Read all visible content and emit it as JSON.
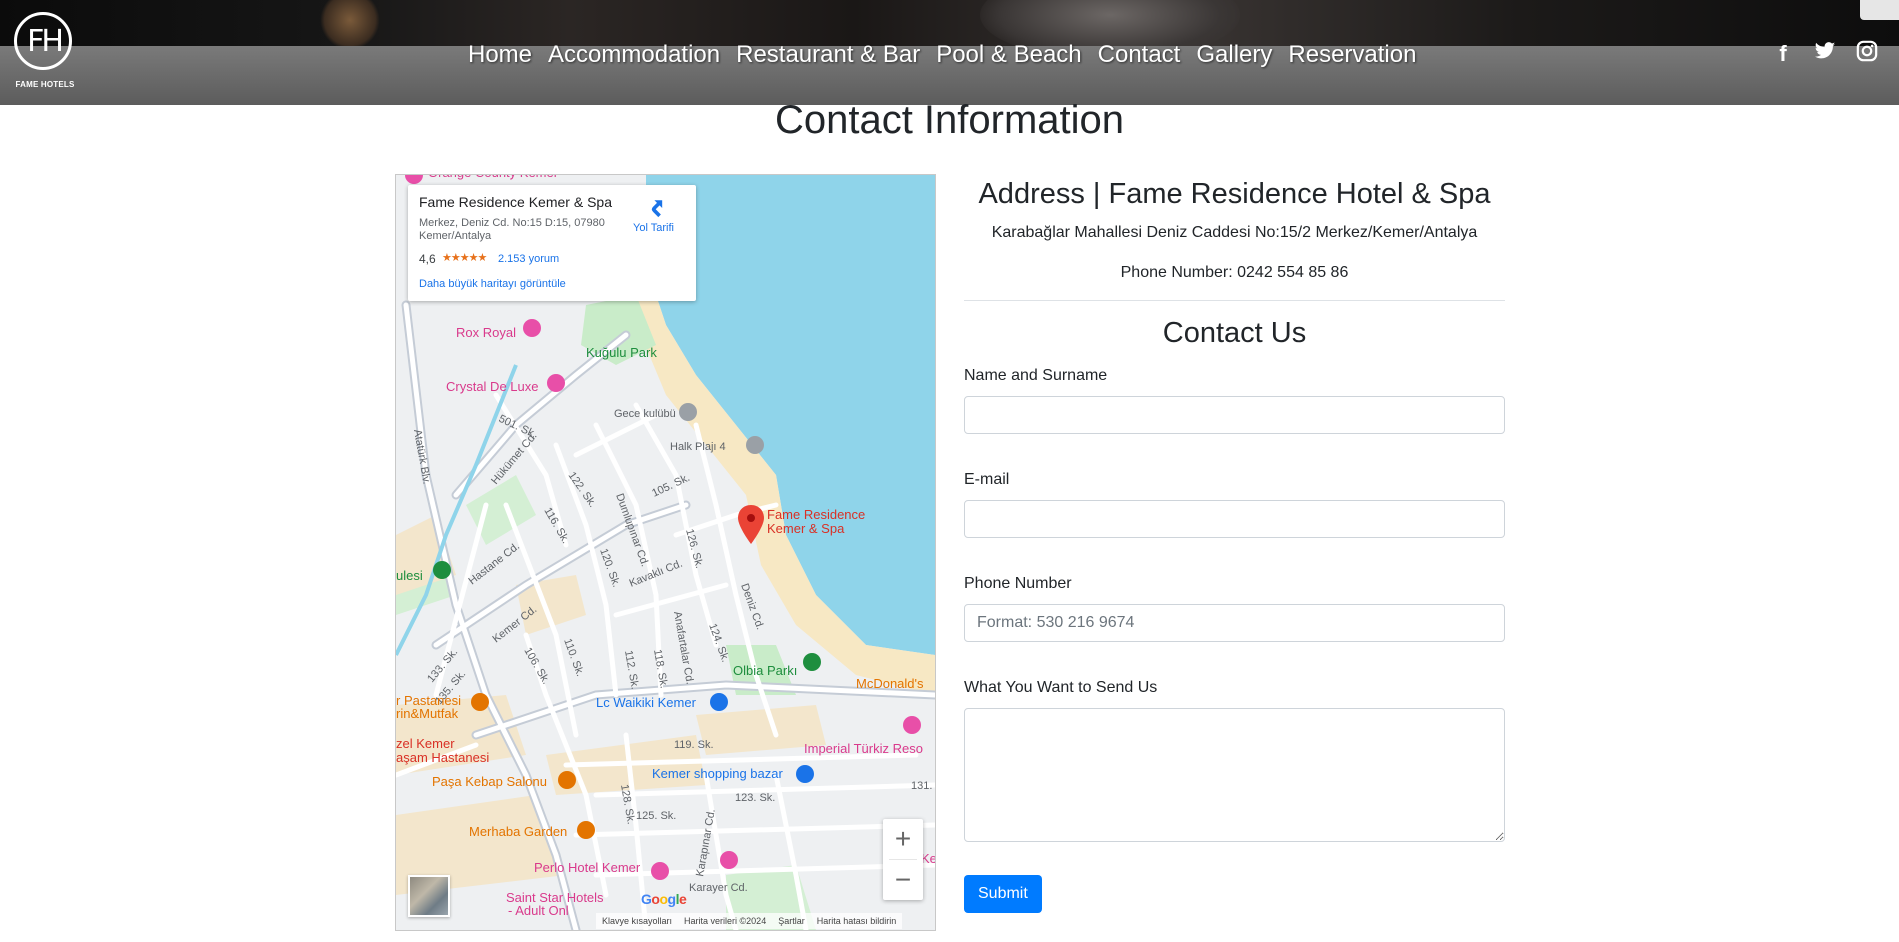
{
  "nav": {
    "brand": "FAME HOTELS",
    "monogram": "FH",
    "items": [
      "Home",
      "Accommodation",
      "Restaurant & Bar",
      "Pool & Beach",
      "Contact",
      "Gallery",
      "Reservation"
    ],
    "social": [
      {
        "icon": "facebook-icon",
        "glyph": "f"
      },
      {
        "icon": "twitter-icon",
        "glyph": "🐦"
      },
      {
        "icon": "instagram-icon",
        "glyph": "◎"
      }
    ]
  },
  "page": {
    "title": "Contact Information"
  },
  "address": {
    "title": "Address | Fame Residence Hotel & Spa",
    "line": "Karabağlar Mahallesi Deniz Caddesi No:15/2 Merkez/Kemer/Antalya",
    "phone": "Phone Number: 0242 554 85 86"
  },
  "form": {
    "title": "Contact Us",
    "name_label": "Name and Surname",
    "name_value": "",
    "email_label": "E-mail",
    "email_value": "",
    "phone_label": "Phone Number",
    "phone_placeholder": "Format: 530 216 9674",
    "message_label": "What You Want to Send Us",
    "submit_label": "Submit"
  },
  "map": {
    "place_name": "Fame Residence Kemer & Spa",
    "place_address": "Merkez, Deniz Cd. No:15 D:15, 07980 Kemer/Antalya",
    "rating": "4,6",
    "stars": "★★★★★",
    "reviews": "2.153 yorum",
    "larger_map": "Daha büyük haritayı görüntüle",
    "directions": "Yol Tarifi",
    "pin_label_1": "Fame Residence",
    "pin_label_2": "Kemer & Spa",
    "google": "Google",
    "footer": [
      "Klavye kısayolları",
      "Harita verileri ©2024",
      "Şartlar",
      "Harita hatası bildirin"
    ],
    "labels": [
      {
        "text": "Orange County Kemer",
        "color": "#d93a8c"
      },
      {
        "text": "Rox Royal",
        "color": "#d93a8c"
      },
      {
        "text": "Kuğulu Park",
        "color": "#1e8e3e"
      },
      {
        "text": "Crystal De Luxe",
        "color": "#d93a8c"
      },
      {
        "text": "Gece kulübü",
        "color": "#5f6368"
      },
      {
        "text": "Halk Plajı 4",
        "color": "#5f6368"
      },
      {
        "text": "501. Sk.",
        "color": "#5f6368"
      },
      {
        "text": "Hükümet Cd.",
        "color": "#5f6368"
      },
      {
        "text": "122. Sk.",
        "color": "#5f6368"
      },
      {
        "text": "116. Sk.",
        "color": "#5f6368"
      },
      {
        "text": "Dumlupınar Cd.",
        "color": "#5f6368"
      },
      {
        "text": "105. Sk.",
        "color": "#5f6368"
      },
      {
        "text": "126. Sk.",
        "color": "#5f6368"
      },
      {
        "text": "120. Sk.",
        "color": "#5f6368"
      },
      {
        "text": "Atatürk Blv.",
        "color": "#5f6368"
      },
      {
        "text": "Hastane Cd.",
        "color": "#5f6368"
      },
      {
        "text": "Kavaklı Cd.",
        "color": "#5f6368"
      },
      {
        "text": "Deniz Cd.",
        "color": "#5f6368"
      },
      {
        "text": "ulesi",
        "color": "#1e8e3e"
      },
      {
        "text": "Kemer Cd.",
        "color": "#5f6368"
      },
      {
        "text": "110. Sk.",
        "color": "#5f6368"
      },
      {
        "text": "Anafartalar Cd.",
        "color": "#5f6368"
      },
      {
        "text": "124. Sk.",
        "color": "#5f6368"
      },
      {
        "text": "133. Sk.",
        "color": "#5f6368"
      },
      {
        "text": "135. Sk.",
        "color": "#5f6368"
      },
      {
        "text": "106. Sk.",
        "color": "#5f6368"
      },
      {
        "text": "112. Sk.",
        "color": "#5f6368"
      },
      {
        "text": "118. Sk.",
        "color": "#5f6368"
      },
      {
        "text": "Olbia Parkı",
        "color": "#1e8e3e"
      },
      {
        "text": "McDonald's",
        "color": "#e37400"
      },
      {
        "text": "r Pastanesi",
        "color": "#e37400"
      },
      {
        "text": "rin&Mutfak",
        "color": "#e37400"
      },
      {
        "text": "Lc Waikiki Kemer",
        "color": "#1a73e8"
      },
      {
        "text": "119. Sk.",
        "color": "#5f6368"
      },
      {
        "text": "zel Kemer",
        "color": "#d93025"
      },
      {
        "text": "aşam Hastanesi",
        "color": "#d93025"
      },
      {
        "text": "Imperial Türkiz Reso",
        "color": "#d93a8c"
      },
      {
        "text": "128. Sk.",
        "color": "#5f6368"
      },
      {
        "text": "Kemer shopping bazar",
        "color": "#1a73e8"
      },
      {
        "text": "Paşa Kebap Salonu",
        "color": "#e37400"
      },
      {
        "text": "123. Sk.",
        "color": "#5f6368"
      },
      {
        "text": "131.",
        "color": "#5f6368"
      },
      {
        "text": "125. Sk.",
        "color": "#5f6368"
      },
      {
        "text": "Merhaba Garden",
        "color": "#e37400"
      },
      {
        "text": "Karapınar Cd.",
        "color": "#5f6368"
      },
      {
        "text": "Ke",
        "color": "#d93a8c"
      },
      {
        "text": "Perlo Hotel Kemer",
        "color": "#d93a8c"
      },
      {
        "text": "Karayer Cd.",
        "color": "#5f6368"
      },
      {
        "text": "Saint Star Hotels",
        "color": "#d93a8c"
      },
      {
        "text": "- Adult Onl",
        "color": "#d93a8c"
      }
    ]
  }
}
